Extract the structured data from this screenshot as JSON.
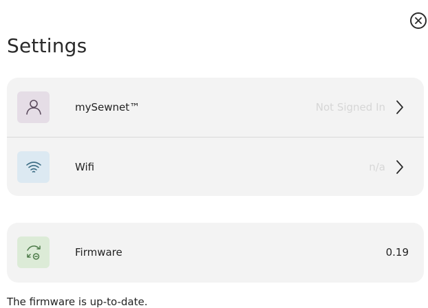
{
  "settings": {
    "title": "Settings",
    "close_icon": "close-circle-icon",
    "items": [
      {
        "label": "mySewnet™",
        "status": "Not Signed In",
        "icon": "user-icon"
      },
      {
        "label": "Wifi",
        "status": "n/a",
        "icon": "wifi-icon"
      }
    ],
    "firmware": {
      "label": "Firmware",
      "version": "0.19",
      "icon": "firmware-update-icon"
    },
    "firmware_message": "The firmware is up-to-date."
  },
  "colors": {
    "card_bg": "#f3f3f3",
    "user_tile": "#e5dde6",
    "wifi_tile": "#dce9f2",
    "firmware_tile": "#dcebd7",
    "muted_text": "#d6d6d6"
  }
}
